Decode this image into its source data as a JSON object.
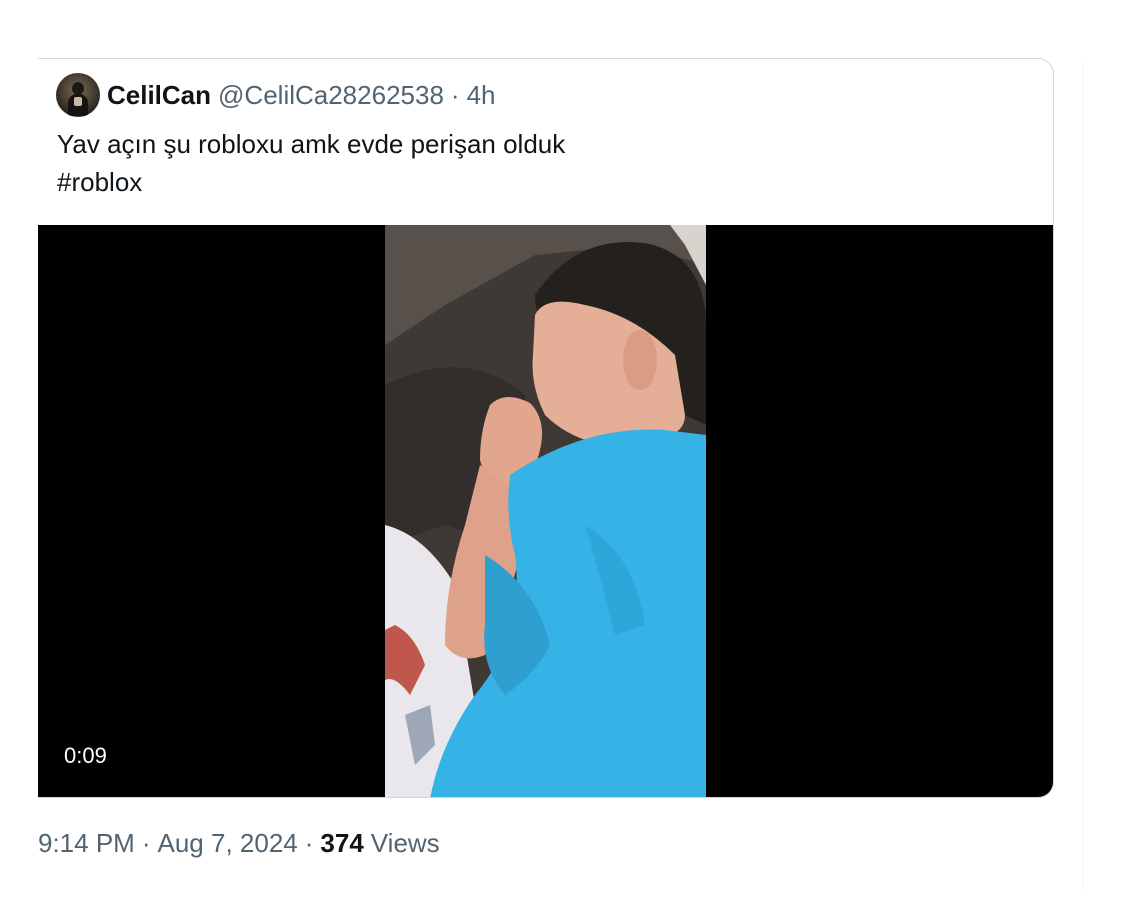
{
  "quoted_tweet": {
    "author": {
      "display_name": "CelilCan",
      "handle": "@CelilCa28262538"
    },
    "separator": "·",
    "relative_time": "4h",
    "text_line1": "Yav açın şu robloxu amk evde perişan olduk",
    "hashtag": "#roblox",
    "video": {
      "duration": "0:09"
    }
  },
  "footer": {
    "time": "9:14 PM",
    "date": "Aug 7, 2024",
    "separator": "·",
    "views_count": "374",
    "views_label": "Views"
  },
  "colors": {
    "text_primary": "#0f1419",
    "text_secondary": "#536471",
    "border": "#cfd9de",
    "video_bg": "#000000",
    "shirt_blue": "#35b3e6"
  }
}
